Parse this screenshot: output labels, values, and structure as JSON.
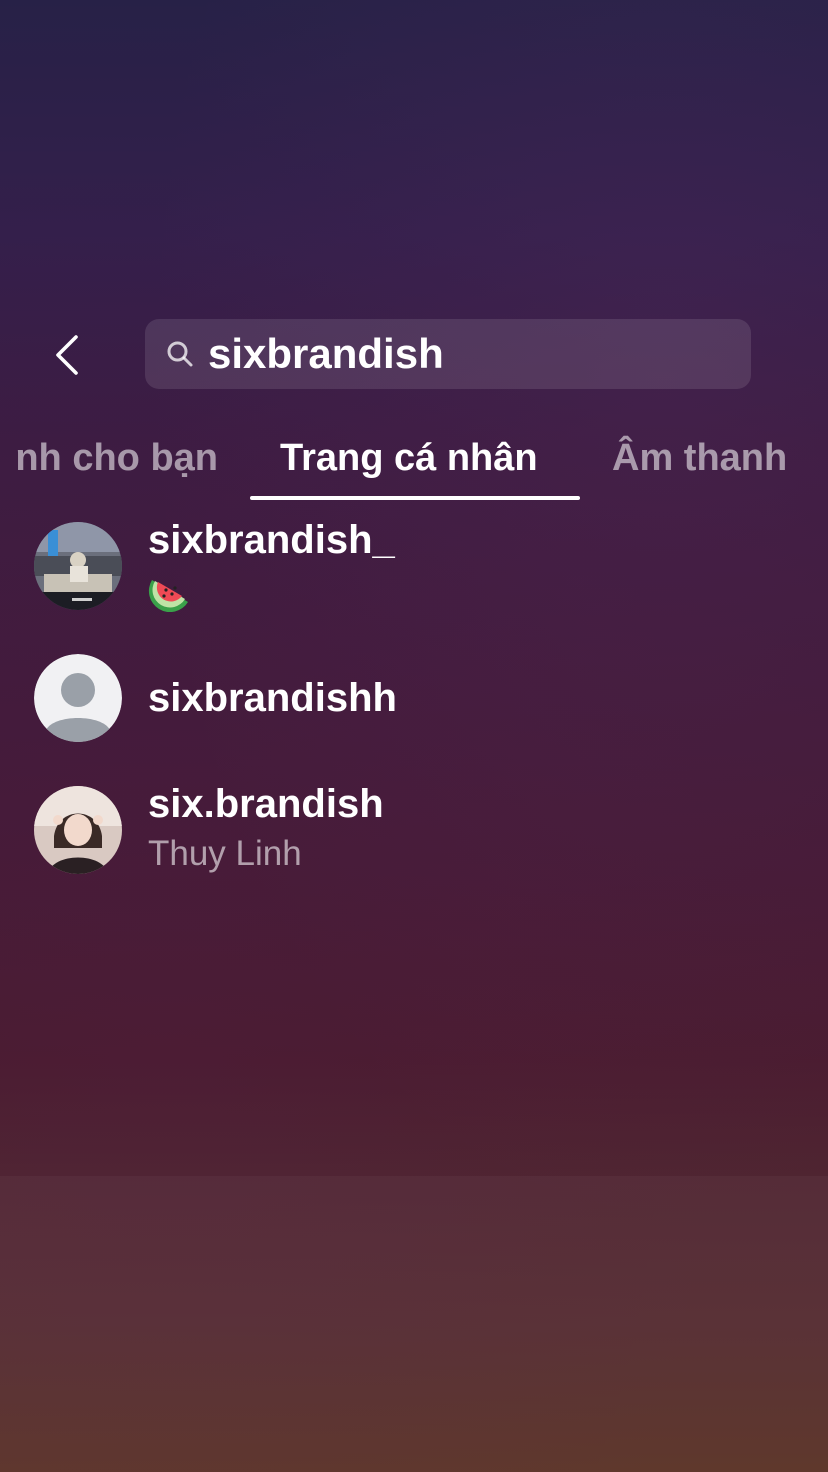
{
  "search": {
    "query": "sixbrandish"
  },
  "tabs": [
    {
      "label": "Dành cho bạn",
      "visible_text": "nh cho bạn",
      "active": false
    },
    {
      "label": "Trang cá nhân",
      "active": true
    },
    {
      "label": "Âm thanh",
      "active": false
    }
  ],
  "results": [
    {
      "username": "sixbrandish_",
      "subtitle_icon": "watermelon-emoji",
      "avatar": "photo-avatar"
    },
    {
      "username": "sixbrandishh",
      "avatar": "default-avatar"
    },
    {
      "username": "six.brandish",
      "subtitle": "Thuy Linh",
      "avatar": "photo-avatar"
    }
  ],
  "colors": {
    "background_top": "#272147",
    "background_bottom": "#5a3125",
    "search_bar_fill": "rgba(255,255,255,0.11)",
    "text_primary": "#ffffff",
    "text_secondary": "rgba(255,255,255,0.58)"
  }
}
